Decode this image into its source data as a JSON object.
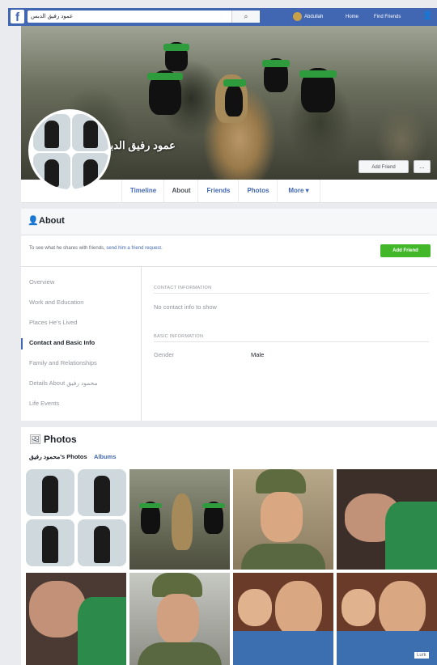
{
  "topbar": {
    "search_value": "عمود رفيق الدبس",
    "user_name": "Abdullah",
    "home_label": "Home",
    "find_friends_label": "Find Friends"
  },
  "cover": {
    "profile_name": "عمود رفيق الدبس",
    "add_friend_label": "Add Friend",
    "more_label": "..."
  },
  "nav_tabs": [
    "Timeline",
    "About",
    "Friends",
    "Photos",
    "More ▾"
  ],
  "about": {
    "title": "About",
    "friend_request_text": "To see what he shares with friends,",
    "friend_request_link": "send him a friend request.",
    "add_friend_label": "Add Friend",
    "nav_items": [
      "Overview",
      "Work and Education",
      "Places He's Lived",
      "Contact and Basic Info",
      "Family and Relationships",
      "Details About محمود رفيق",
      "Life Events"
    ],
    "contact_section_title": "CONTACT INFORMATION",
    "no_contact": "No contact info to show",
    "basic_section_title": "BASIC INFORMATION",
    "gender_label": "Gender",
    "gender_value": "Male"
  },
  "photos": {
    "title": "Photos",
    "tab_1": "محمود رفيق's Photos",
    "tab_2": "Albums"
  },
  "corner_badge": "Lurk"
}
